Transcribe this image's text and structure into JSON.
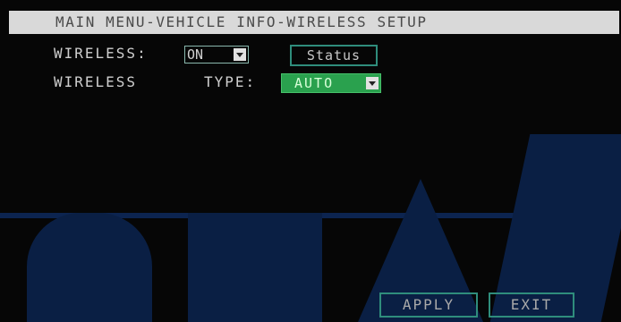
{
  "title": "MAIN MENU-VEHICLE INFO-WIRELESS SETUP",
  "wireless": {
    "label": "WIRELESS:",
    "value": "ON",
    "status_button": "Status"
  },
  "wireless_type": {
    "label_word": "WIRELESS",
    "label_type": "TYPE:",
    "value": "AUTO"
  },
  "buttons": {
    "apply": "APPLY",
    "exit": "EXIT"
  },
  "colors": {
    "title_bg": "#d9d9d9",
    "selected_green": "#2aa14e",
    "button_border": "#2f8d7c",
    "watermark": "#0a1f44"
  }
}
